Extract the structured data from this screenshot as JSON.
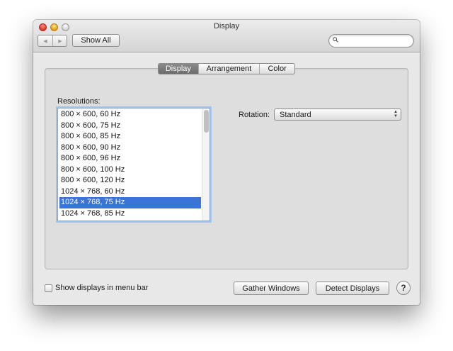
{
  "window": {
    "title": "Display"
  },
  "toolbar": {
    "back_glyph": "◀",
    "forward_glyph": "▶",
    "show_all_label": "Show All",
    "search_placeholder": ""
  },
  "tabs": [
    {
      "label": "Display",
      "selected": true
    },
    {
      "label": "Arrangement",
      "selected": false
    },
    {
      "label": "Color",
      "selected": false
    }
  ],
  "resolutions": {
    "label": "Resolutions:",
    "items": [
      "800 × 600, 60 Hz",
      "800 × 600, 75 Hz",
      "800 × 600, 85 Hz",
      "800 × 600, 90 Hz",
      "800 × 600, 96 Hz",
      "800 × 600, 100 Hz",
      "800 × 600, 120 Hz",
      "1024 × 768, 60 Hz",
      "1024 × 768, 75 Hz",
      "1024 × 768, 85 Hz"
    ],
    "selected_index": 8
  },
  "rotation": {
    "label": "Rotation:",
    "value": "Standard"
  },
  "footer": {
    "menu_bar_label": "Show displays in menu bar",
    "menu_bar_checked": false,
    "gather_label": "Gather Windows",
    "detect_label": "Detect Displays",
    "help_label": "?"
  },
  "colors": {
    "selection": "#3a75d6",
    "focus_ring": "#a8c3ea",
    "selected_tab": "#6c6c6c"
  },
  "icons": [
    "close-icon",
    "minimize-icon",
    "zoom-icon",
    "back-arrow-icon",
    "forward-arrow-icon",
    "search-icon",
    "chevron-updown-icon",
    "help-icon"
  ]
}
